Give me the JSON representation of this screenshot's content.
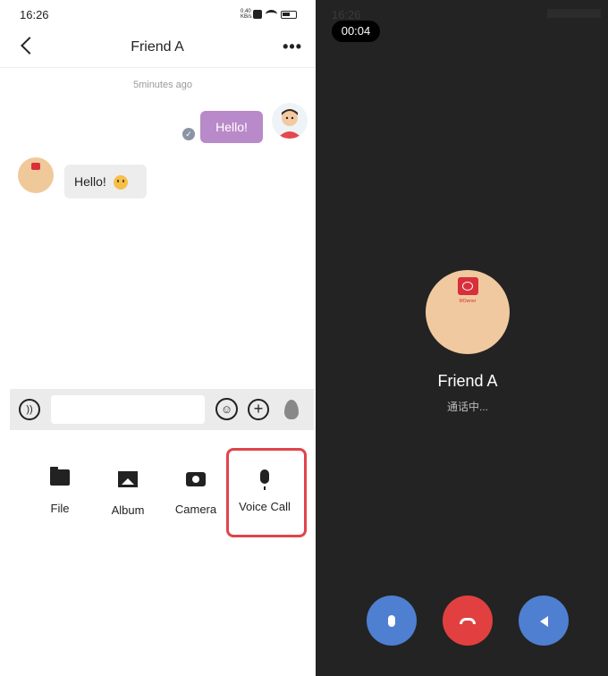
{
  "left": {
    "status_time": "16:26",
    "status_kbs": "0.40 KB/s",
    "header": {
      "title": "Friend A",
      "more_icon": "more-dots-icon",
      "back_icon": "chevron-left-icon"
    },
    "chat": {
      "timestamp": "5minutes ago",
      "messages": [
        {
          "from": "me",
          "text": "Hello!"
        },
        {
          "from": "friend",
          "text": "Hello!"
        }
      ]
    },
    "input": {
      "placeholder": ""
    },
    "tray": [
      {
        "label": "File",
        "icon": "folder-icon"
      },
      {
        "label": "Album",
        "icon": "image-icon"
      },
      {
        "label": "Camera",
        "icon": "camera-icon"
      },
      {
        "label": "Voice Call",
        "icon": "microphone-icon"
      }
    ],
    "colors": {
      "my_bubble": "#b98ac9",
      "highlight": "#e0444b"
    }
  },
  "right": {
    "status_time": "16:26",
    "timer": "00:04",
    "avatar_logo_text": "MOwner",
    "caller_name": "Friend A",
    "call_status": "通话中...",
    "colors": {
      "background": "#232323",
      "mic": "#4e7fd1",
      "hangup": "#e24040",
      "speaker": "#4e7fd1"
    }
  }
}
